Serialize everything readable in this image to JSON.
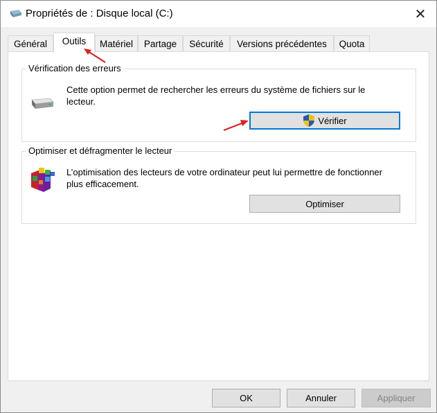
{
  "window": {
    "title": "Propriétés de : Disque local (C:)",
    "close_label": "✕"
  },
  "tabs": [
    {
      "label": "Général",
      "active": false
    },
    {
      "label": "Outils",
      "active": true
    },
    {
      "label": "Matériel",
      "active": false
    },
    {
      "label": "Partage",
      "active": false
    },
    {
      "label": "Sécurité",
      "active": false
    },
    {
      "label": "Versions précédentes",
      "active": false
    },
    {
      "label": "Quota",
      "active": false
    }
  ],
  "error_check": {
    "title": "Vérification des erreurs",
    "description_line1": "Cette option permet de rechercher les erreurs du système de fichiers sur le",
    "description_line2": "lecteur.",
    "button_label": "Vérifier"
  },
  "optimize": {
    "title": "Optimiser et défragmenter le lecteur",
    "description_line1": "L’optimisation des lecteurs de votre ordinateur peut lui permettre de fonctionner",
    "description_line2": "plus efficacement.",
    "button_label": "Optimiser"
  },
  "footer": {
    "ok_label": "OK",
    "cancel_label": "Annuler",
    "apply_label": "Appliquer"
  },
  "colors": {
    "focus_border": "#0078d7",
    "annotation_arrow": "#e02020"
  }
}
